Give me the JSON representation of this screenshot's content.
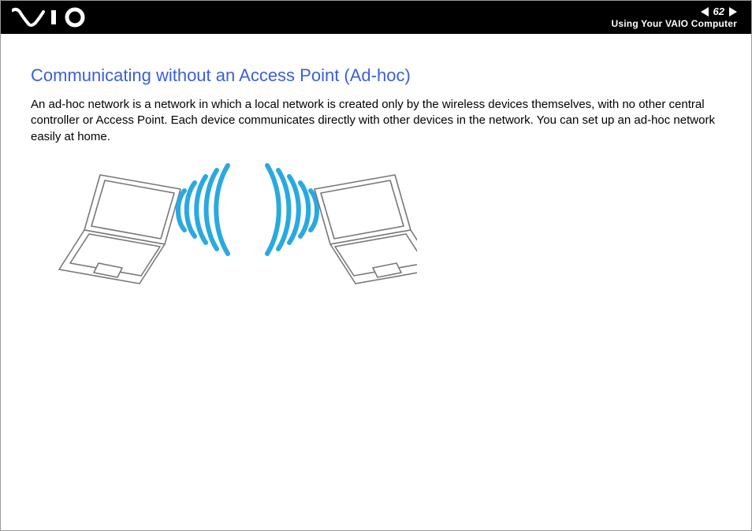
{
  "header": {
    "page_number": "62",
    "section": "Using Your VAIO Computer"
  },
  "content": {
    "heading": "Communicating without an Access Point (Ad-hoc)",
    "paragraph": "An ad-hoc network is a network in which a local network is created only by the wireless devices themselves, with no other central controller or Access Point. Each device communicates directly with other devices in the network. You can set up an ad-hoc network easily at home."
  },
  "illustration": {
    "description": "Two laptops communicating directly via wireless signals (ad-hoc)",
    "signal_color": "#2aa9e0",
    "laptop_stroke": "#777",
    "laptop_fill": "#fff"
  }
}
